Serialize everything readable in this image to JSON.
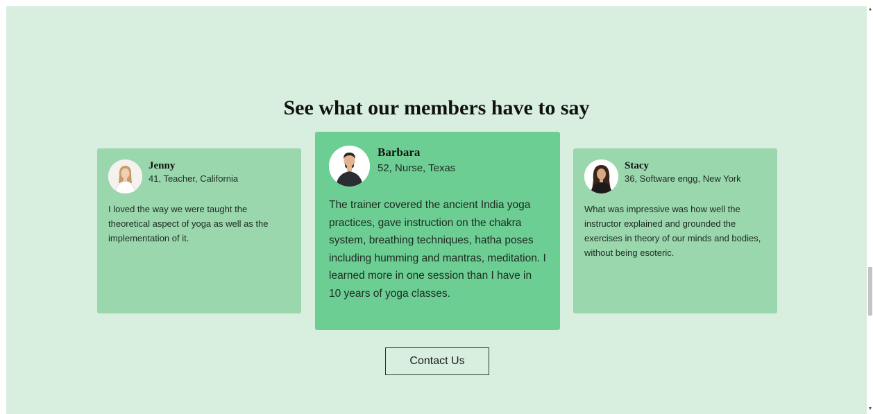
{
  "section": {
    "heading": "See what our members have to say"
  },
  "testimonials": [
    {
      "name": "Jenny",
      "details": "41, Teacher, California",
      "quote": "I loved the way we were taught the theoretical aspect of yoga as well as the implementation of it.",
      "avatar_icon": "woman-avatar-icon"
    },
    {
      "name": "Barbara",
      "details": "52, Nurse, Texas",
      "quote": "The trainer covered the ancient India yoga practices, gave instruction on the chakra system, breathing techniques, hatha poses including humming and mantras, meditation. I learned more in one session than I have in 10 years of yoga classes.",
      "avatar_icon": "man-avatar-icon"
    },
    {
      "name": "Stacy",
      "details": "36, Software engg, New York",
      "quote": "What was impressive was how well the instructor explained and grounded the exercises in theory of our minds and bodies, without being esoteric.",
      "avatar_icon": "woman-avatar-icon"
    }
  ],
  "cta": {
    "label": "Contact Us"
  },
  "colors": {
    "background": "#d8efdf",
    "side_card": "#9ad7ad",
    "center_card": "#6cce92"
  }
}
